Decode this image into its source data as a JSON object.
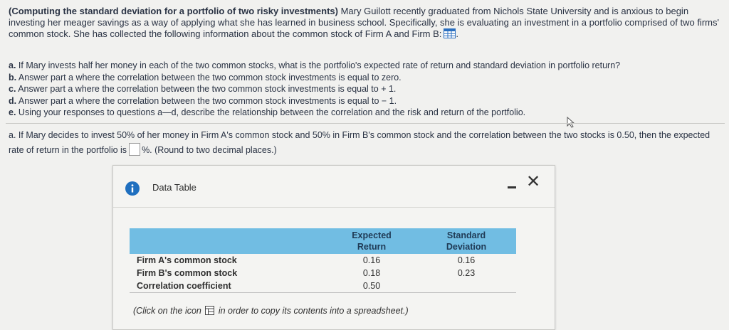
{
  "intro": {
    "bold_title": "(Computing the standard deviation for a portfolio of two risky investments)",
    "text": " Mary Guilott recently graduated from Nichols State University and is anxious to begin investing her meager savings as a way of applying what she has learned in business school. Specifically, she is evaluating an investment in a portfolio comprised of two firms' common stock. She has collected the following information about the common stock of Firm A and Firm B:",
    "end": "."
  },
  "questions": [
    {
      "letter": "a.",
      "text": " If Mary invests half her money in each of the two common stocks, what is the portfolio's expected rate of return and standard deviation in portfolio return?"
    },
    {
      "letter": "b.",
      "text": " Answer part a where the correlation between the two common stock investments is equal to zero."
    },
    {
      "letter": "c.",
      "text": " Answer part a where the correlation between the two common stock investments is equal to  + 1."
    },
    {
      "letter": "d.",
      "text": " Answer part a where the correlation between the two common stock investments is equal to  − 1."
    },
    {
      "letter": "e.",
      "text": " Using your responses to questions a—d, describe the relationship between the correlation and the risk and return of the portfolio."
    }
  ],
  "part_a": {
    "text_before": "a. If Mary decides to invest 50% of her money in Firm A's common stock and 50% in Firm B's common stock and the correlation between the two stocks is 0.50, then the expected rate of return in the portfolio is",
    "answer_value": "",
    "text_after": "%.  (Round to two decimal places.)"
  },
  "dialog": {
    "title": "Data Table",
    "minimize_label": "minimize",
    "close_label": "✕",
    "table": {
      "headers": [
        "",
        "Expected Return",
        "Standard Deviation"
      ],
      "header_lines": [
        [
          "",
          ""
        ],
        [
          "Expected",
          "Return"
        ],
        [
          "Standard",
          "Deviation"
        ]
      ],
      "rows": [
        {
          "label": "Firm A's common stock",
          "expected_return": "0.16",
          "std_dev": "0.16"
        },
        {
          "label": "Firm B's common stock",
          "expected_return": "0.18",
          "std_dev": "0.23"
        },
        {
          "label": "Correlation coefficient",
          "expected_return": "0.50",
          "std_dev": ""
        }
      ]
    },
    "copy_note_before": "(Click on the icon",
    "copy_note_after": "in order to copy its contents into a spreadsheet.)"
  },
  "colors": {
    "header_fill": "#71bde3",
    "info_icon": "#1f6fbf",
    "grid_icon": "#2a6fc0"
  }
}
